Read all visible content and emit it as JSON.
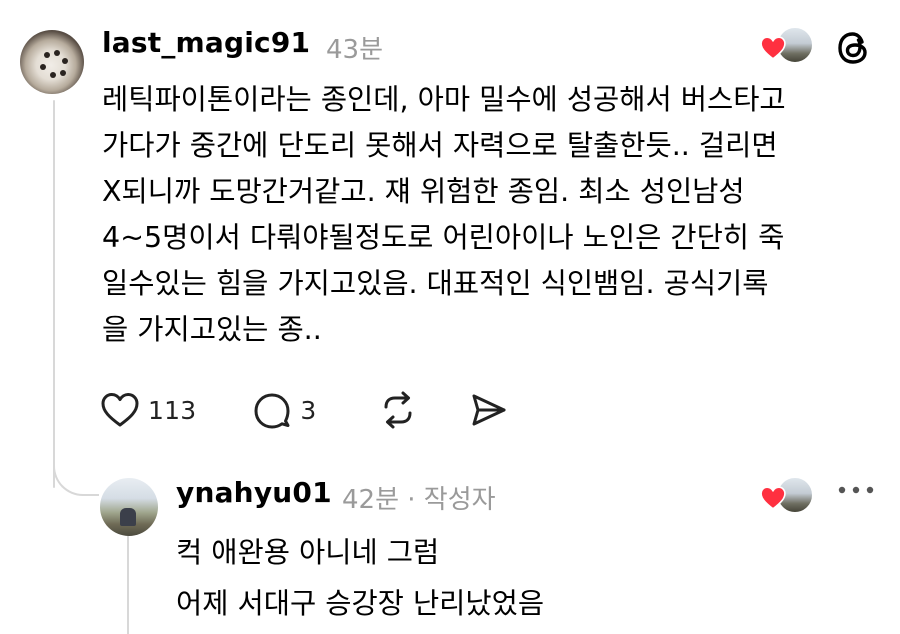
{
  "comment": {
    "username": "last_magic91",
    "timestamp": "43분",
    "body_lines": [
      "레틱파이톤이라는 종인데, 아마 밀수에 성공해서 버스타고",
      "가다가 중간에 단도리 못해서 자력으로 탈출한듯.. 걸리면",
      "X되니까 도망간거같고. 쟤 위험한 종임. 최소 성인남성",
      "4~5명이서 다뤄야될정도로 어린아이나 노인은 간단히 죽",
      "일수있는 힘을 가지고있음. 대표적인 식인뱀임. 공식기록",
      "을 가지고있는 종.."
    ],
    "actions": {
      "like_icon": "heart-outline-icon",
      "like_count": "113",
      "reply_icon": "speech-bubble-icon",
      "reply_count": "3",
      "repost_icon": "repost-icon",
      "share_icon": "send-icon"
    },
    "liked_by_author": true
  },
  "reply": {
    "username": "ynahyu01",
    "timestamp": "42분 · 작성자",
    "body_lines": [
      "컥 애완용 아니네 그럼",
      "어제 서대구 승강장 난리났었음"
    ],
    "liked_by_author": true
  },
  "icons": {
    "app_logo": "threads-logo-icon",
    "more": "more-horizontal-icon",
    "liked_heart": "heart-filled-icon"
  },
  "colors": {
    "text": "#000000",
    "muted": "#9a9a9a",
    "heart": "#ff3040",
    "thread_line": "#d8d8d8"
  }
}
